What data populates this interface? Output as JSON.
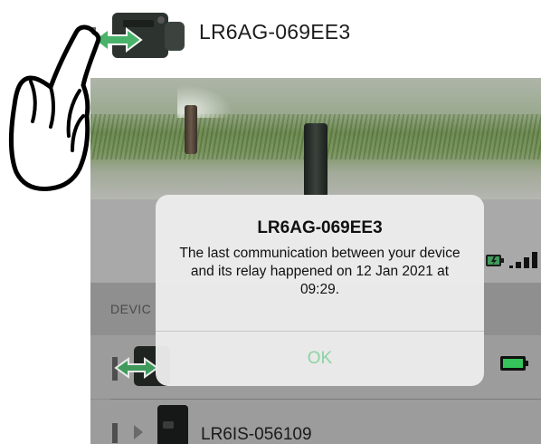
{
  "header": {
    "device_name": "LR6AG-069EE3"
  },
  "screen": {
    "section_label": "DEVIC",
    "devices": [
      {
        "name": "",
        "icon": "relay-link-icon",
        "battery": "full"
      },
      {
        "name": "LR6IS-056109",
        "icon": "device-thumbnail-icon"
      }
    ]
  },
  "alert": {
    "title": "LR6AG-069EE3",
    "message": "The last communication between your device and its relay happened on 12 Jan 2021 at 09:29.",
    "ok_label": "OK"
  },
  "colors": {
    "accent_green": "#4ab36b",
    "ok_text": "#8dd3a2"
  }
}
